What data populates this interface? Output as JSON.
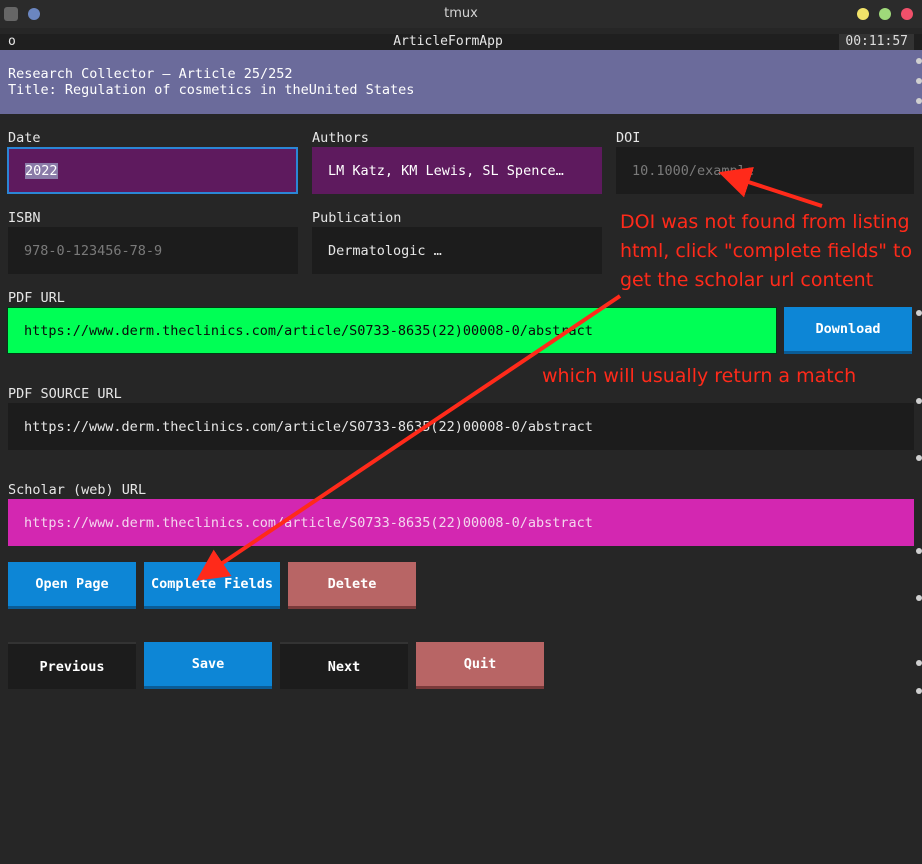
{
  "window": {
    "title": "tmux"
  },
  "app": {
    "name": "ArticleFormApp",
    "left_indicator": "o",
    "clock": "00:11:57"
  },
  "banner": {
    "line1": "Research Collector – Article 25/252",
    "line2": "Title: Regulation of cosmetics in theUnited States"
  },
  "fields": {
    "date": {
      "label": "Date",
      "value": "2022"
    },
    "authors": {
      "label": "Authors",
      "value": "LM Katz, KM Lewis, SL Spence…"
    },
    "doi": {
      "label": "DOI",
      "placeholder": "10.1000/example"
    },
    "isbn": {
      "label": "ISBN",
      "placeholder": "978-0-123456-78-9"
    },
    "publication": {
      "label": "Publication",
      "value": "Dermatologic …"
    },
    "pdf_url": {
      "label": "PDF URL",
      "value": "https://www.derm.theclinics.com/article/S0733-8635(22)00008-0/abstract"
    },
    "pdf_source_url": {
      "label": "PDF SOURCE URL",
      "value": "https://www.derm.theclinics.com/article/S0733-8635(22)00008-0/abstract"
    },
    "scholar_url": {
      "label": "Scholar (web) URL",
      "value": "https://www.derm.theclinics.com/article/S0733-8635(22)00008-0/abstract"
    }
  },
  "buttons": {
    "download": "Download",
    "open_page": "Open Page",
    "complete_fields": "Complete Fields",
    "delete": "Delete",
    "previous": "Previous",
    "save": "Save",
    "next": "Next",
    "quit": "Quit"
  },
  "annotations": {
    "doi_note": [
      "DOI was not found from listing",
      "html, click \"complete fields\" to",
      "get the scholar url content"
    ],
    "match_note": "which will usually return a match"
  },
  "colors": {
    "accent_blue": "#0d86d6",
    "focused_field": "#5e1a5e",
    "pdf_url_green": "#00ff55",
    "scholar_magenta": "#d327b1",
    "danger": "#b86565",
    "annotation_red": "#ff2a1a"
  },
  "icons": [
    "app-icon",
    "window-close-icon",
    "window-maximize-icon",
    "window-minimize-icon",
    "arrow-icon"
  ]
}
